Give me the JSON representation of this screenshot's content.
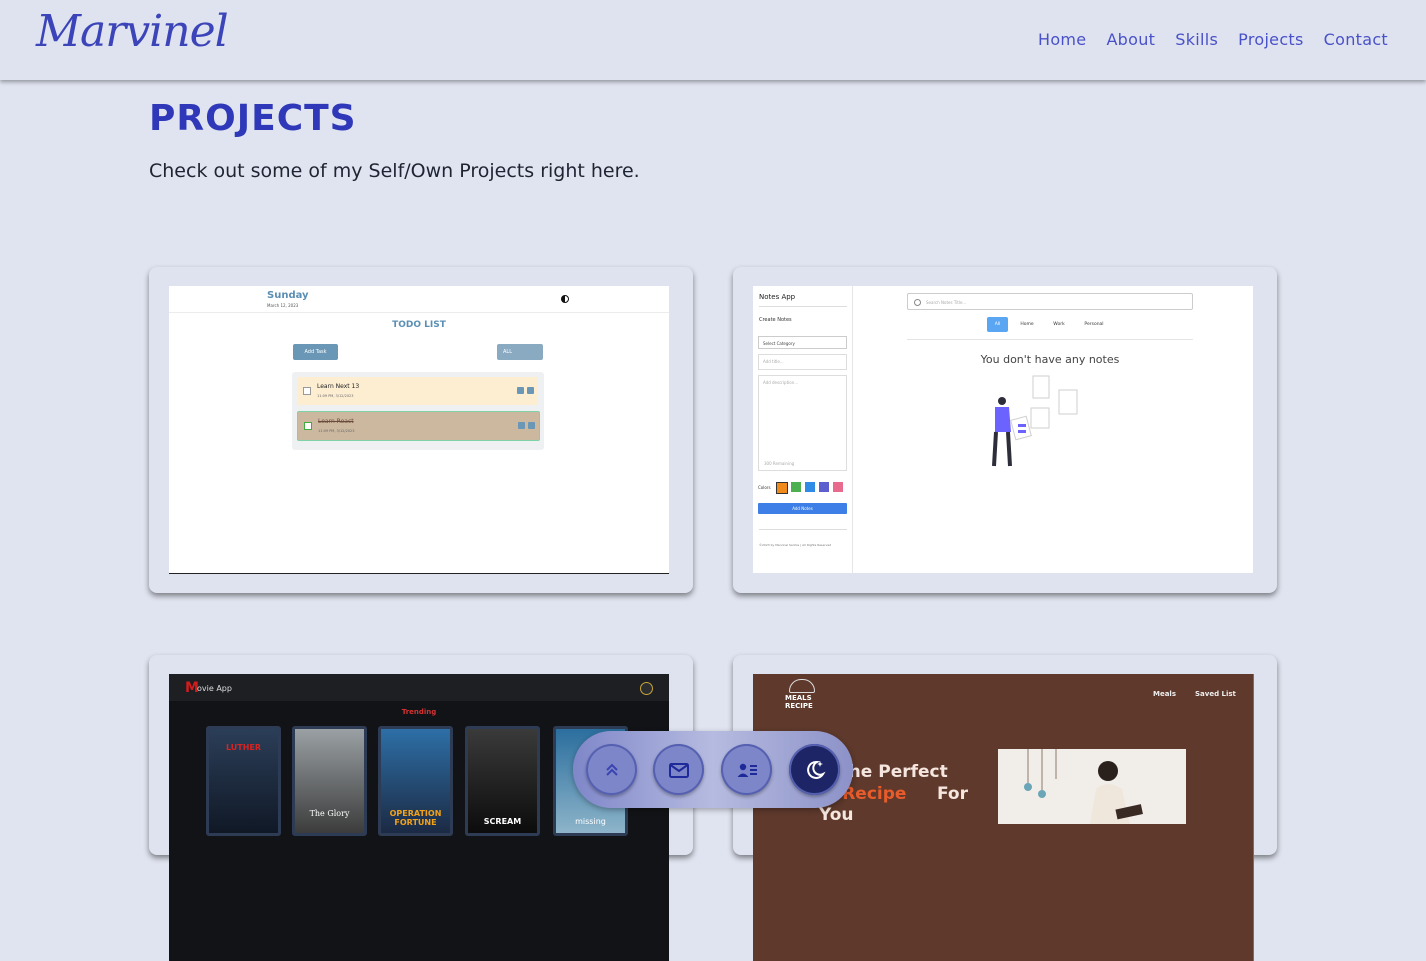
{
  "header": {
    "brand": "Marvinel",
    "nav": [
      "Home",
      "About",
      "Skills",
      "Projects",
      "Contact"
    ]
  },
  "section": {
    "title": "PROJECTS",
    "subtitle": "Check out some of my Self/Own Projects right here."
  },
  "projects": {
    "todo": {
      "day": "Sunday",
      "date": "March 12, 2023",
      "title": "TODO LIST",
      "add_button": "Add Task",
      "filter": "ALL",
      "items": [
        {
          "title": "Learn Next 13",
          "date": "11:09 PM, 3/12/2023"
        },
        {
          "title": "Learn React",
          "date": "11:09 PM, 3/12/2023"
        }
      ]
    },
    "notes": {
      "app_title": "Notes App",
      "create_label": "Create Notes",
      "category_placeholder": "Select Category",
      "title_placeholder": "Add title...",
      "description_placeholder": "Add description...",
      "remaining": "300 Remaining",
      "colors_label": "Colors",
      "add_button": "Add Notes",
      "footer": "©2023 by Marvinel Santos | All Rights Reserved",
      "search_placeholder": "Search Notes Title...",
      "tabs": [
        "All",
        "Home",
        "Work",
        "Personal"
      ],
      "empty_message": "You don't have any notes",
      "swatch_colors": [
        "#f08a1a",
        "#4caf50",
        "#2f8be6",
        "#5d5fcf",
        "#e86a8c"
      ]
    },
    "movie": {
      "logo_letter": "M",
      "logo_rest": "ovie App",
      "trending": "Trending",
      "posters": [
        "LUTHER",
        "The Glory",
        "OPERATION FORTUNE",
        "SCREAM",
        "missing"
      ]
    },
    "meals": {
      "logo": "MEALS RECIPE",
      "nav": [
        "Meals",
        "Saved List"
      ],
      "hero_line1": "d The Perfect",
      "hero_line2_accent": "al Recipe",
      "hero_line2_rest": "For",
      "hero_line3": "You"
    }
  },
  "dock": {
    "icons": [
      "chevrons-up-icon",
      "mail-icon",
      "contact-card-icon",
      "moon-stars-icon"
    ]
  },
  "colors": {
    "background": "#e0e4f0",
    "accent": "#2e38b8",
    "nav_text": "#4951c9"
  }
}
